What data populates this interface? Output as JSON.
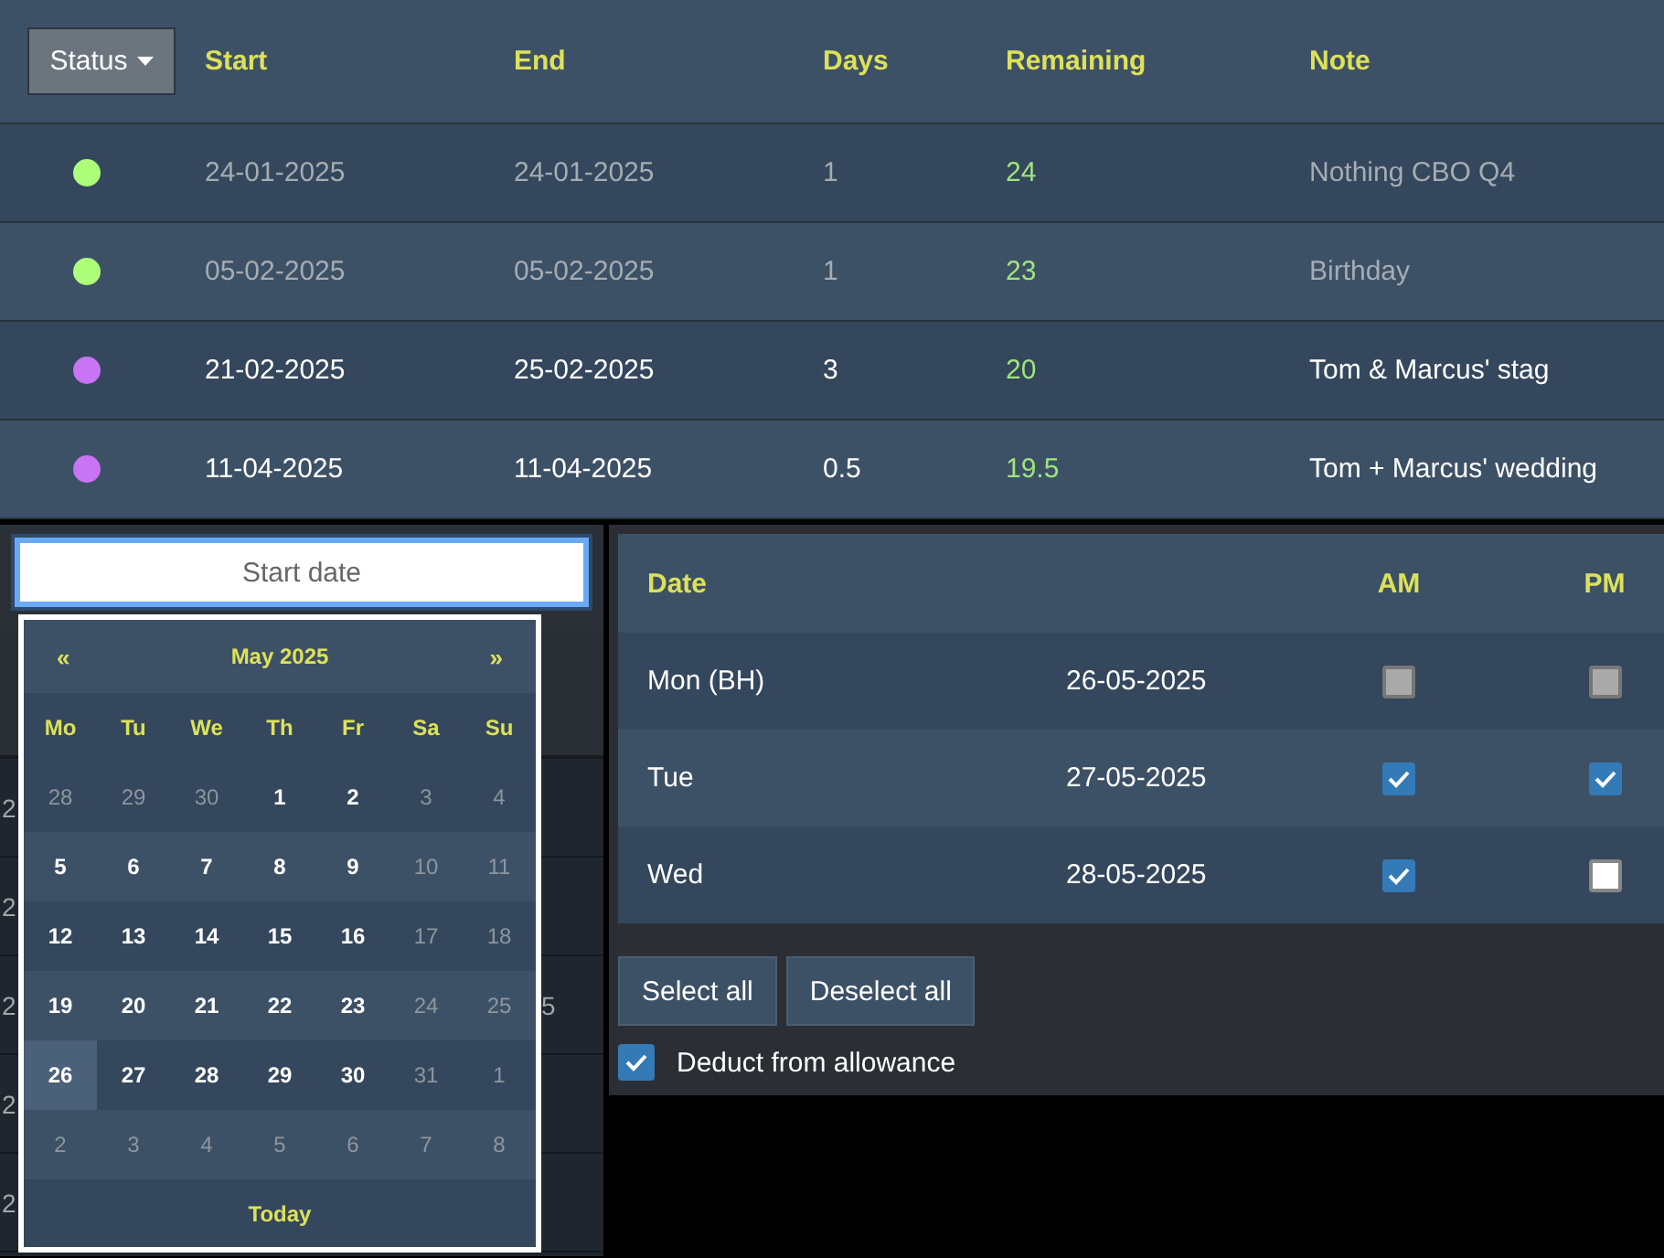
{
  "table": {
    "columns": [
      {
        "label": "Status",
        "kind": "dropdown"
      },
      {
        "label": "Start",
        "kind": "text"
      },
      {
        "label": "End",
        "kind": "text"
      },
      {
        "label": "Days",
        "kind": "text"
      },
      {
        "label": "Remaining",
        "kind": "text"
      },
      {
        "label": "Note",
        "kind": "text"
      }
    ],
    "rows": [
      {
        "color": "#adff7a",
        "start": "24-01-2025",
        "end": "24-01-2025",
        "days": "1",
        "remaining": "24",
        "note": "Nothing CBO Q4",
        "dimmed": true
      },
      {
        "color": "#adff7a",
        "start": "05-02-2025",
        "end": "05-02-2025",
        "days": "1",
        "remaining": "23",
        "note": "Birthday",
        "dimmed": true
      },
      {
        "color": "#c774f5",
        "start": "21-02-2025",
        "end": "25-02-2025",
        "days": "3",
        "remaining": "20",
        "note": "Tom & Marcus' stag",
        "dimmed": false
      },
      {
        "color": "#c774f5",
        "start": "11-04-2025",
        "end": "11-04-2025",
        "days": "0.5",
        "remaining": "19.5",
        "note": "Tom + Marcus' wedding",
        "dimmed": false
      }
    ]
  },
  "start_field": {
    "placeholder": "Start date"
  },
  "behind_rows": [
    {
      "column_1": "2"
    },
    {
      "column_1": "2"
    },
    {
      "column_1": "2",
      "column_2": "5"
    },
    {
      "column_1": "2"
    },
    {
      "column_1": "2"
    }
  ],
  "calendar": {
    "prev": "«",
    "title": "May 2025",
    "next": "»",
    "weekdays": [
      "Mo",
      "Tu",
      "We",
      "Th",
      "Fr",
      "Sa",
      "Su"
    ],
    "weeks": [
      [
        {
          "day": "28",
          "muted": true,
          "selected": false
        },
        {
          "day": "29",
          "muted": true,
          "selected": false
        },
        {
          "day": "30",
          "muted": true,
          "selected": false
        },
        {
          "day": "1",
          "muted": false,
          "selected": false
        },
        {
          "day": "2",
          "muted": false,
          "selected": false
        },
        {
          "day": "3",
          "muted": true,
          "selected": false
        },
        {
          "day": "4",
          "muted": true,
          "selected": false
        }
      ],
      [
        {
          "day": "5",
          "muted": false,
          "selected": false
        },
        {
          "day": "6",
          "muted": false,
          "selected": false
        },
        {
          "day": "7",
          "muted": false,
          "selected": false
        },
        {
          "day": "8",
          "muted": false,
          "selected": false
        },
        {
          "day": "9",
          "muted": false,
          "selected": false
        },
        {
          "day": "10",
          "muted": true,
          "selected": false
        },
        {
          "day": "11",
          "muted": true,
          "selected": false
        }
      ],
      [
        {
          "day": "12",
          "muted": false,
          "selected": false
        },
        {
          "day": "13",
          "muted": false,
          "selected": false
        },
        {
          "day": "14",
          "muted": false,
          "selected": false
        },
        {
          "day": "15",
          "muted": false,
          "selected": false
        },
        {
          "day": "16",
          "muted": false,
          "selected": false
        },
        {
          "day": "17",
          "muted": true,
          "selected": false
        },
        {
          "day": "18",
          "muted": true,
          "selected": false
        }
      ],
      [
        {
          "day": "19",
          "muted": false,
          "selected": false
        },
        {
          "day": "20",
          "muted": false,
          "selected": false
        },
        {
          "day": "21",
          "muted": false,
          "selected": false
        },
        {
          "day": "22",
          "muted": false,
          "selected": false
        },
        {
          "day": "23",
          "muted": false,
          "selected": false
        },
        {
          "day": "24",
          "muted": true,
          "selected": false
        },
        {
          "day": "25",
          "muted": true,
          "selected": false
        }
      ],
      [
        {
          "day": "26",
          "muted": false,
          "selected": true
        },
        {
          "day": "27",
          "muted": false,
          "selected": false
        },
        {
          "day": "28",
          "muted": false,
          "selected": false
        },
        {
          "day": "29",
          "muted": false,
          "selected": false
        },
        {
          "day": "30",
          "muted": false,
          "selected": false
        },
        {
          "day": "31",
          "muted": true,
          "selected": false
        },
        {
          "day": "1",
          "muted": true,
          "selected": false
        }
      ],
      [
        {
          "day": "2",
          "muted": true,
          "selected": false
        },
        {
          "day": "3",
          "muted": true,
          "selected": false
        },
        {
          "day": "4",
          "muted": true,
          "selected": false
        },
        {
          "day": "5",
          "muted": true,
          "selected": false
        },
        {
          "day": "6",
          "muted": true,
          "selected": false
        },
        {
          "day": "7",
          "muted": true,
          "selected": false
        },
        {
          "day": "8",
          "muted": true,
          "selected": false
        }
      ]
    ],
    "today": "Today"
  },
  "day_table": {
    "columns": [
      "Date",
      "AM",
      "PM"
    ],
    "rows": [
      {
        "day": "Mon (BH)",
        "date": "26-05-2025",
        "am": {
          "checked": false,
          "disabled": true
        },
        "pm": {
          "checked": false,
          "disabled": true
        }
      },
      {
        "day": "Tue",
        "date": "27-05-2025",
        "am": {
          "checked": true,
          "disabled": false
        },
        "pm": {
          "checked": true,
          "disabled": false
        }
      },
      {
        "day": "Wed",
        "date": "28-05-2025",
        "am": {
          "checked": true,
          "disabled": false
        },
        "pm": {
          "checked": false,
          "disabled": false
        }
      }
    ]
  },
  "buttons": [
    "Select all",
    "Deselect all"
  ],
  "deduct": {
    "label": "Deduct from allowance",
    "checked": true
  }
}
